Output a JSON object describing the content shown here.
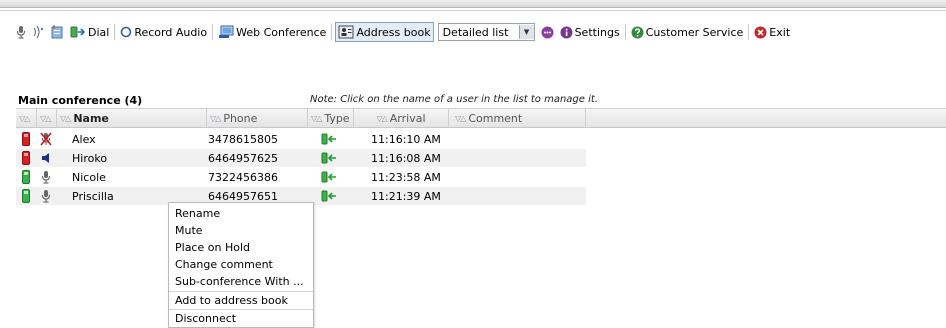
{
  "toolbar": {
    "dial_label": "Dial",
    "record_label": "Record Audio",
    "webconf_label": "Web Conference",
    "addressbook_label": "Address book",
    "view_select_value": "Detailed list",
    "settings_label": "Settings",
    "customer_service_label": "Customer Service",
    "exit_label": "Exit"
  },
  "conference": {
    "title": "Main conference (4)",
    "note": "Note: Click on the name of a user in the list to manage it."
  },
  "table": {
    "headers": {
      "name": "Name",
      "phone": "Phone",
      "type": "Type",
      "arrival": "Arrival",
      "comment": "Comment"
    },
    "rows": [
      {
        "status": "red",
        "audio": "muted-mic",
        "name": "Alex",
        "phone": "3478615805",
        "arrival": "11:16:10 AM",
        "comment": ""
      },
      {
        "status": "red",
        "audio": "speaker",
        "name": "Hiroko",
        "phone": "6464957625",
        "arrival": "11:16:08 AM",
        "comment": ""
      },
      {
        "status": "green",
        "audio": "microphone",
        "name": "Nicole",
        "phone": "7322456386",
        "arrival": "11:23:58 AM",
        "comment": ""
      },
      {
        "status": "green",
        "audio": "microphone",
        "name": "Priscilla",
        "phone": "6464957651",
        "arrival": "11:21:39 AM",
        "comment": ""
      }
    ]
  },
  "context_menu": {
    "items": [
      "Rename",
      "Mute",
      "Place on Hold",
      "Change comment",
      "Sub-conference With ...",
      "Add to address book",
      "Disconnect"
    ]
  },
  "colors": {
    "status_red": "#d8201f",
    "status_green": "#3bb34a",
    "incoming_arrow": "#1f9e2c",
    "settings_purple": "#8a3fa0",
    "exit_red": "#c62828",
    "help_green": "#2e8b3a"
  }
}
